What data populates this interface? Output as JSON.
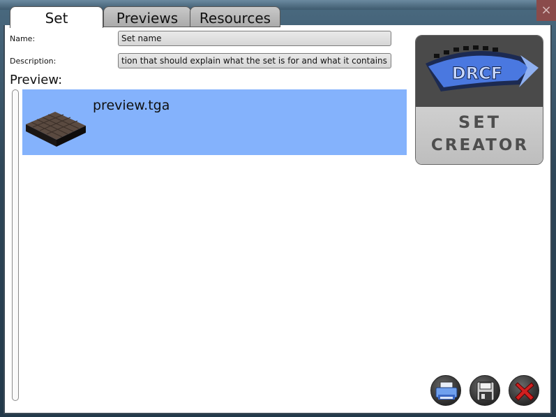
{
  "background": {
    "close_glyph": "×"
  },
  "tabs": [
    {
      "label": "Set",
      "active": true
    },
    {
      "label": "Previews",
      "active": false
    },
    {
      "label": "Resources",
      "active": false
    }
  ],
  "form": {
    "name_label": "Name:",
    "name_value": "Set name",
    "description_label": "Description:",
    "description_value": "tion that should explain what the set is for and what it contains"
  },
  "preview": {
    "label": "Preview:",
    "items": [
      {
        "name": "preview.tga",
        "selected": true
      }
    ]
  },
  "logo": {
    "brand": "DRCF",
    "line1": "SET",
    "line2": "CREATOR"
  },
  "actions": {
    "print_icon": "printer-icon",
    "save_icon": "floppy-disk-icon",
    "close_icon": "red-x-icon"
  },
  "colors": {
    "selection": "#84b2fc",
    "logo_blue": "#4a78e0",
    "close_red": "#d02020"
  }
}
